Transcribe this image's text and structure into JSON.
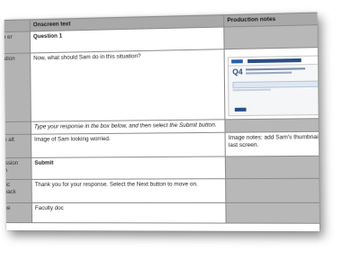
{
  "table": {
    "headers": [
      "",
      "Onscreen text",
      "Production notes"
    ],
    "rows": [
      {
        "label": "n\ner",
        "text": "Question 1",
        "notes": ""
      },
      {
        "label": "ation",
        "text": " Now, what should Sam do in this situation?",
        "notes": ""
      },
      {
        "label": "",
        "text": "Type your response in the box below, and then select the Submit button.",
        "notes": ""
      },
      {
        "label": "e alt",
        "text": "Image of Sam looking worried.",
        "notes": "Image notes: add Sam's thumbnail; r\nlast screen."
      },
      {
        "label": "ission\nn",
        "text": "Submit",
        "notes": ""
      },
      {
        "label": "ric\nback",
        "text": "Thank you for your response. Select the Next button to move on.",
        "notes": ""
      },
      {
        "label": "ce",
        "text": "Faculty doc",
        "notes": ""
      }
    ]
  },
  "thumbnail": {
    "question_number": "Q4"
  }
}
